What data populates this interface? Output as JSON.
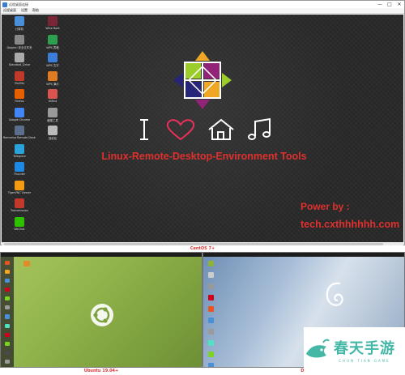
{
  "top_window": {
    "title": "远程桌面连接",
    "menu": [
      "远程桌面",
      "设置",
      "帮助"
    ],
    "window_buttons": [
      "—",
      "□",
      "✕"
    ],
    "left_icons": [
      {
        "label": "计算机",
        "icon": "computer-icon",
        "color": "#4a90d9"
      },
      {
        "label": "Dolphin 安全文件夹",
        "icon": "folder-icon",
        "color": "#888888"
      },
      {
        "label": "Standard_Drive",
        "icon": "drive-icon",
        "color": "#aaaaaa"
      },
      {
        "label": "FileZilla",
        "icon": "filezilla-icon",
        "color": "#c0392b"
      },
      {
        "label": "Firefox",
        "icon": "firefox-icon",
        "color": "#e66000"
      },
      {
        "label": "Google Chrome",
        "icon": "chrome-icon",
        "color": "#4285f4"
      },
      {
        "label": "Remmina Remote Desktop Client",
        "icon": "remmina-icon",
        "color": "#5b6e8c"
      },
      {
        "label": "Telegram",
        "icon": "telegram-icon",
        "color": "#2aa3dc"
      },
      {
        "label": "Thunder",
        "icon": "thunder-icon",
        "color": "#1e88e5"
      },
      {
        "label": "TigerVNC Viewer",
        "icon": "tigervnc-icon",
        "color": "#f39c12"
      },
      {
        "label": "Transmission",
        "icon": "transmission-icon",
        "color": "#c0392b"
      },
      {
        "label": "WeChat",
        "icon": "wechat-icon",
        "color": "#2dc100"
      }
    ],
    "right_icons": [
      {
        "label": "Wine Boot",
        "icon": "wine-icon",
        "color": "#7a2636"
      },
      {
        "label": "WPS 表格",
        "icon": "wps-sheet-icon",
        "color": "#2e9e4f"
      },
      {
        "label": "WPS 文字",
        "icon": "wps-writer-icon",
        "color": "#3b7dd8"
      },
      {
        "label": "WPS 演示",
        "icon": "wps-slides-icon",
        "color": "#e07b24"
      },
      {
        "label": "XMind",
        "icon": "xmind-icon",
        "color": "#d9534f"
      },
      {
        "label": "截图工具",
        "icon": "screenshot-icon",
        "color": "#999999"
      },
      {
        "label": "回收站",
        "icon": "trash-icon",
        "color": "#bbbbbb"
      }
    ],
    "title_tools": "Linux-Remote-Desktop-Environment Tools",
    "power_by": "Power by :",
    "power_site": "tech.cxthhhhhh.com",
    "colors": {
      "accent": "#e0302e",
      "desktop": "#262626"
    }
  },
  "captions": {
    "centos": "CentOS 7+",
    "ubuntu": "Ubuntu 19.04+",
    "debian": "De"
  },
  "ubuntu": {
    "dock_colors": [
      "#e95420",
      "#f5a623",
      "#4a90d9",
      "#d0021b",
      "#7ed321",
      "#9b9b9b",
      "#4a90d9",
      "#50e3c2",
      "#d0021b",
      "#7ed321",
      "#4a4a4a",
      "#9b9b9b"
    ]
  },
  "debian": {
    "icon_colors": [
      "#8fb339",
      "#cccccc",
      "#999999",
      "#d0021b",
      "#e95420",
      "#4a90d9",
      "#9b9b9b",
      "#50e3c2",
      "#7ed321",
      "#4a90d9"
    ]
  },
  "watermark": {
    "main": "春天手游",
    "sub": "CHUN TIAN GAME"
  }
}
